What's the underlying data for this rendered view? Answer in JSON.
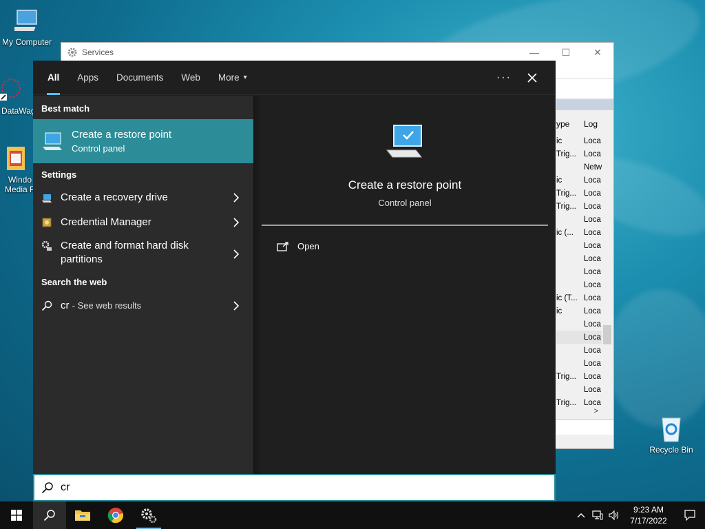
{
  "desktop": {
    "icons": [
      {
        "label": "My Computer",
        "icon": "computer-icon"
      },
      {
        "label": "DataWag",
        "icon": "datawag-icon"
      },
      {
        "label": "Windo Media P",
        "icon": "media-player-icon"
      },
      {
        "label": "Recycle Bin",
        "icon": "recycle-bin-icon"
      }
    ]
  },
  "services_window": {
    "title": "Services",
    "minimize": "—",
    "maximize": "☐",
    "close": "✕",
    "columns": [
      "ype",
      "Log"
    ],
    "rows": [
      [
        "ic",
        "Loca"
      ],
      [
        "Trig...",
        "Loca"
      ],
      [
        "",
        "Netw"
      ],
      [
        "ic",
        "Loca"
      ],
      [
        "Trig...",
        "Loca"
      ],
      [
        "Trig...",
        "Loca"
      ],
      [
        "",
        "Loca"
      ],
      [
        "ic (...",
        "Loca"
      ],
      [
        "",
        "Loca"
      ],
      [
        "",
        "Loca"
      ],
      [
        "",
        "Loca"
      ],
      [
        "",
        "Loca"
      ],
      [
        "ic (T...",
        "Loca"
      ],
      [
        "ic",
        "Loca"
      ],
      [
        "",
        "Loca"
      ],
      [
        "",
        "Loca"
      ],
      [
        "",
        "Loca"
      ],
      [
        "",
        "Loca"
      ],
      [
        "Trig...",
        "Loca"
      ],
      [
        "",
        "Loca"
      ],
      [
        "Trig...",
        "Loca"
      ]
    ],
    "hscroll_arrow": ">"
  },
  "search": {
    "tabs": [
      {
        "label": "All",
        "active": true
      },
      {
        "label": "Apps"
      },
      {
        "label": "Documents"
      },
      {
        "label": "Web"
      },
      {
        "label": "More"
      }
    ],
    "more_caret": "▾",
    "options_dots": "···",
    "best_match_heading": "Best match",
    "best_match": {
      "title": "Create a restore point",
      "subtitle": "Control panel",
      "icon": "restore-point-icon"
    },
    "settings_heading": "Settings",
    "settings_results": [
      {
        "label": "Create a recovery drive",
        "icon": "recovery-drive-icon"
      },
      {
        "label": "Credential Manager",
        "icon": "credential-manager-icon"
      },
      {
        "label": "Create and format hard disk partitions",
        "icon": "disk-management-icon"
      }
    ],
    "web_heading": "Search the web",
    "web_result": {
      "query": "cr",
      "suffix": "- See web results",
      "icon": "search-icon"
    },
    "preview": {
      "title": "Create a restore point",
      "subtitle": "Control panel",
      "action": "Open"
    },
    "query": "cr"
  },
  "taskbar": {
    "pinned": [
      "start-icon",
      "search-icon",
      "file-explorer-icon",
      "chrome-icon",
      "services-icon"
    ],
    "time": "9:23 AM",
    "date": "7/17/2022"
  },
  "colors": {
    "accent": "#2c8d99",
    "tab_underline": "#4cc2ff",
    "flyout_bg": "#1f1f1f",
    "pane_bg": "#2b2b2b"
  }
}
